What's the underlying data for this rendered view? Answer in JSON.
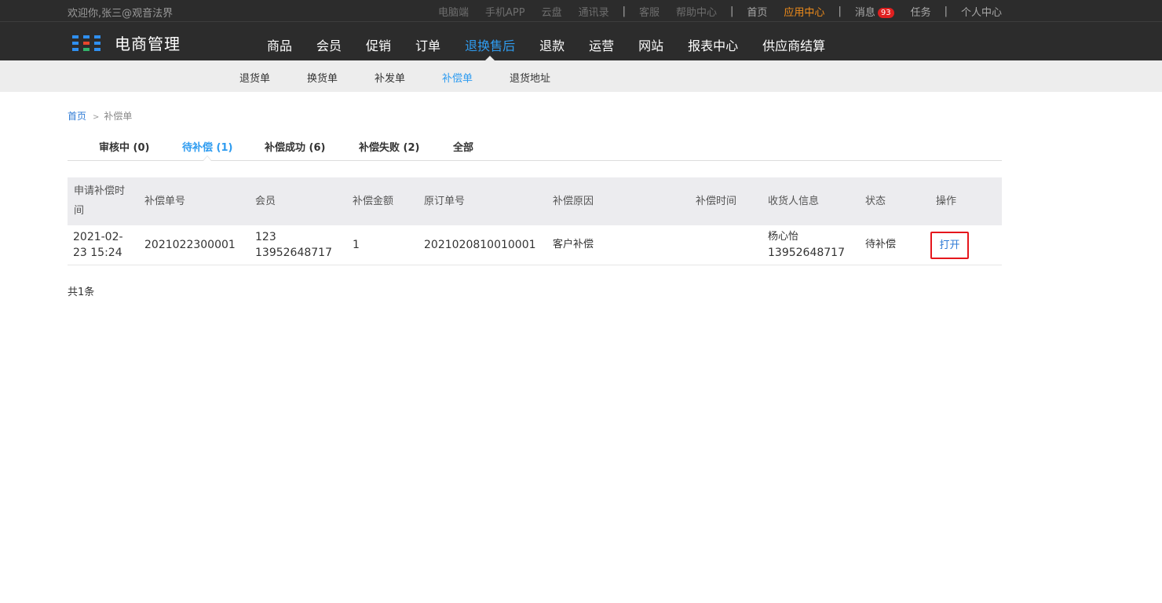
{
  "topbar": {
    "welcome": "欢迎你,张三@观音法界",
    "links": {
      "pc": "电脑端",
      "app": "手机APP",
      "cloud": "云盘",
      "contacts": "通讯录",
      "service": "客服",
      "help": "帮助中心",
      "home": "首页",
      "app_center": "应用中心",
      "messages": "消息",
      "messages_count": "93",
      "tasks": "任务",
      "profile": "个人中心"
    },
    "separator": "|"
  },
  "brand": {
    "title": "电商管理",
    "icon": "grid-logo-icon",
    "colors": [
      "#2f8ff0",
      "#e8462c",
      "#33b36b",
      "#f5a623"
    ]
  },
  "main_nav": [
    "商品",
    "会员",
    "促销",
    "订单",
    "退换售后",
    "退款",
    "运营",
    "网站",
    "报表中心",
    "供应商结算"
  ],
  "main_nav_active": "退换售后",
  "sub_nav": [
    "退货单",
    "换货单",
    "补发单",
    "补偿单",
    "退货地址"
  ],
  "sub_nav_active": "补偿单",
  "breadcrumb": {
    "home": "首页",
    "arrow": ">",
    "current": "补偿单"
  },
  "tabs": [
    {
      "label": "审核中 (0)"
    },
    {
      "label": "待补偿 (1)"
    },
    {
      "label": "补偿成功 (6)"
    },
    {
      "label": "补偿失败 (2)"
    },
    {
      "label": "全部"
    }
  ],
  "tabs_active": "待补偿 (1)",
  "table": {
    "headers": {
      "apply_time_1": "申请补偿时",
      "apply_time_2": "间",
      "comp_no": "补偿单号",
      "member": "会员",
      "amount": "补偿金额",
      "orig_order": "原订单号",
      "reason": "补偿原因",
      "comp_time": "补偿时间",
      "receiver": "收货人信息",
      "status": "状态",
      "action": "操作"
    },
    "rows": [
      {
        "apply_date": "2021-02-",
        "apply_time": "23 15:24",
        "comp_no": "2021022300001",
        "member_name": "123",
        "member_phone": "13952648717",
        "amount": "1",
        "orig_order": "2021020810010001",
        "reason": "客户补偿",
        "comp_time": "",
        "receiver_name": "杨心怡",
        "receiver_phone": "13952648717",
        "status": "待补偿",
        "action": "打开"
      }
    ]
  },
  "total": "共1条",
  "colors": {
    "header_bg": "#2c2c2c",
    "accent_blue": "#2f9cf0",
    "orange": "#f08c1a",
    "highlight_red": "#e5161c"
  }
}
